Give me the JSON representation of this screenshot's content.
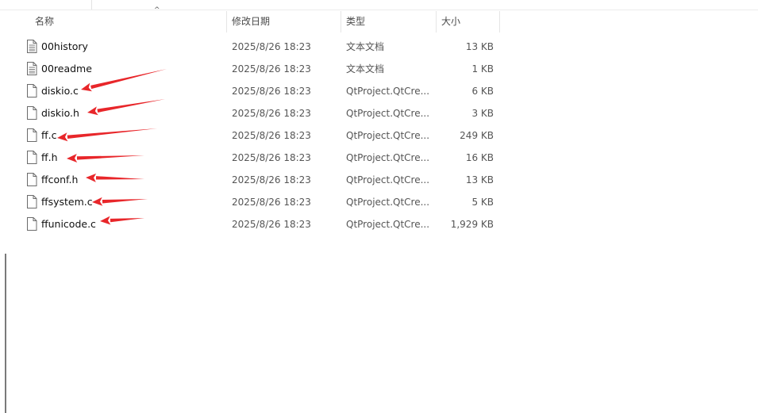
{
  "columns": {
    "name": "名称",
    "date": "修改日期",
    "type": "类型",
    "size": "大小"
  },
  "sort_indicator": "^",
  "colors": {
    "annotation_arrow": "#e8262a",
    "header_text": "#4a4a4a",
    "muted_text": "#555555"
  },
  "files": [
    {
      "name": "00history",
      "date": "2025/8/26 18:23",
      "type": "文本文档",
      "size": "13 KB",
      "icon": "text-document-icon"
    },
    {
      "name": "00readme",
      "date": "2025/8/26 18:23",
      "type": "文本文档",
      "size": "1 KB",
      "icon": "text-document-icon"
    },
    {
      "name": "diskio.c",
      "date": "2025/8/26 18:23",
      "type": "QtProject.QtCre...",
      "size": "6 KB",
      "icon": "blank-file-icon"
    },
    {
      "name": "diskio.h",
      "date": "2025/8/26 18:23",
      "type": "QtProject.QtCre...",
      "size": "3 KB",
      "icon": "blank-file-icon"
    },
    {
      "name": "ff.c",
      "date": "2025/8/26 18:23",
      "type": "QtProject.QtCre...",
      "size": "249 KB",
      "icon": "blank-file-icon"
    },
    {
      "name": "ff.h",
      "date": "2025/8/26 18:23",
      "type": "QtProject.QtCre...",
      "size": "16 KB",
      "icon": "blank-file-icon"
    },
    {
      "name": "ffconf.h",
      "date": "2025/8/26 18:23",
      "type": "QtProject.QtCre...",
      "size": "13 KB",
      "icon": "blank-file-icon"
    },
    {
      "name": "ffsystem.c",
      "date": "2025/8/26 18:23",
      "type": "QtProject.QtCre...",
      "size": "5 KB",
      "icon": "blank-file-icon"
    },
    {
      "name": "ffunicode.c",
      "date": "2025/8/26 18:23",
      "type": "QtProject.QtCre...",
      "size": "1,929 KB",
      "icon": "blank-file-icon"
    }
  ]
}
